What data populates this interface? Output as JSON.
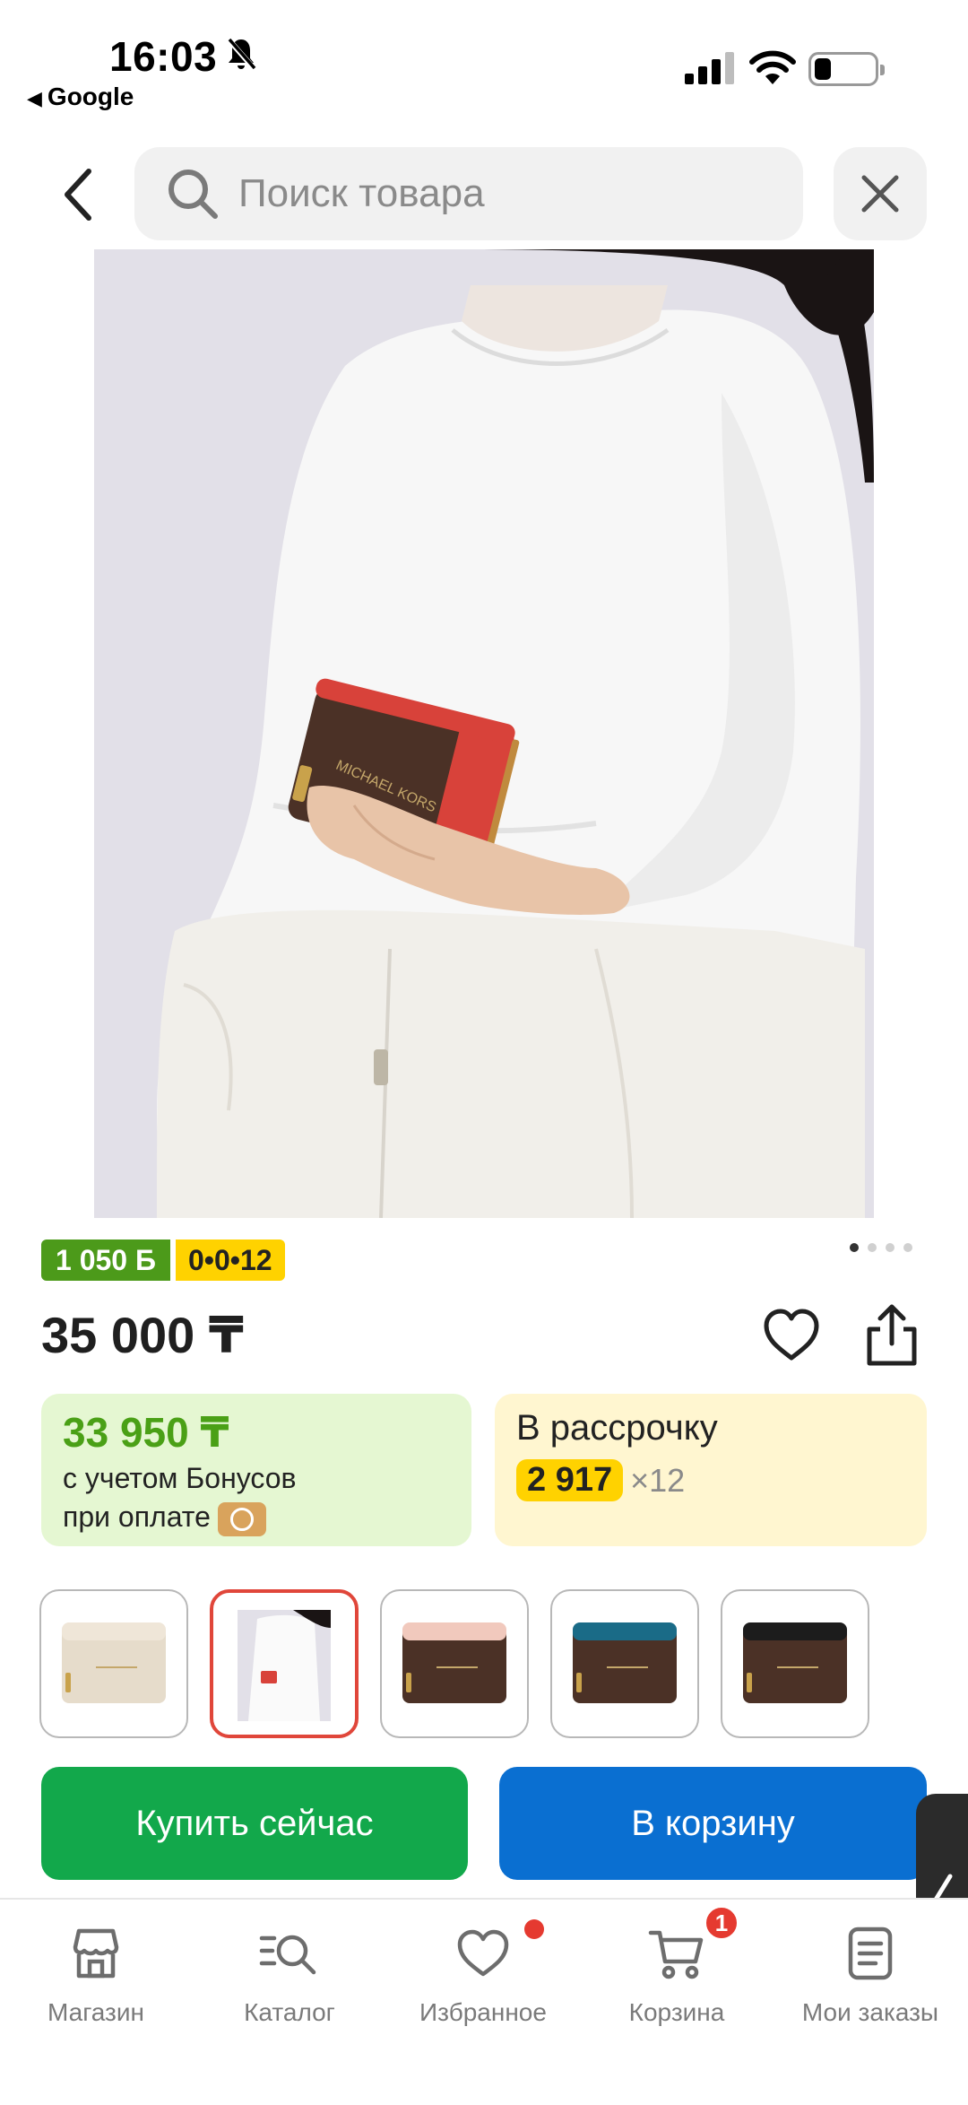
{
  "status_bar": {
    "time": "16:03",
    "back_app": "Google"
  },
  "search": {
    "placeholder": "Поиск товара"
  },
  "product": {
    "bonus_badge": "1 050 Б",
    "installment_badge": "0•0•12",
    "price": "35 000 ₸",
    "bonus_card": {
      "amount": "33 950 ₸",
      "line1": "с учетом Бонусов",
      "line2": "при оплате"
    },
    "installment_card": {
      "title": "В рассрочку",
      "monthly": "2 917",
      "months": "×12"
    },
    "gallery": {
      "total": 4,
      "active_index": 0
    },
    "thumbnails": [
      {
        "name": "beige-wallet",
        "color": "#efe6d8",
        "active": false
      },
      {
        "name": "model-photo",
        "color": "#e2e0e8",
        "active": true
      },
      {
        "name": "pink-brown-wallet",
        "color": "#f1c9bd",
        "active": false
      },
      {
        "name": "teal-brown-wallet",
        "color": "#1a6b87",
        "active": false
      },
      {
        "name": "black-brown-wallet",
        "color": "#1c1c1c",
        "active": false
      }
    ]
  },
  "actions": {
    "buy_now": "Купить сейчас",
    "add_to_cart": "В корзину"
  },
  "nav": {
    "items": [
      {
        "label": "Магазин",
        "icon": "shop-icon"
      },
      {
        "label": "Каталог",
        "icon": "catalog-icon"
      },
      {
        "label": "Избранное",
        "icon": "heart-icon"
      },
      {
        "label": "Корзина",
        "icon": "cart-icon"
      },
      {
        "label": "Мои заказы",
        "icon": "orders-icon"
      }
    ],
    "cart_count": "1"
  },
  "colors": {
    "buy_green": "#12a84b",
    "cart_blue": "#0a6fd1",
    "bonus_green": "#4c9a1a",
    "installment_yellow": "#ffd200",
    "badge_red": "#e53a30"
  }
}
